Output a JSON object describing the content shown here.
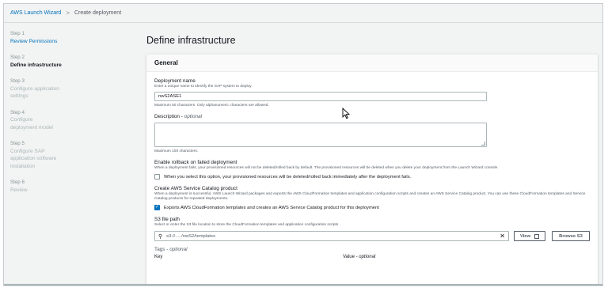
{
  "breadcrumb": {
    "root": "AWS Launch Wizard",
    "separator": ">",
    "current": "Create deployment"
  },
  "steps": [
    {
      "num": "Step 1",
      "title": "Review Permissions",
      "state": "done"
    },
    {
      "num": "Step 2",
      "title": "Define infrastructure",
      "state": "current"
    },
    {
      "num": "Step 3",
      "title": "Configure application settings",
      "state": "pending"
    },
    {
      "num": "Step 4",
      "title": "Configure deployment model",
      "state": "pending"
    },
    {
      "num": "Step 5",
      "title": "Configure SAP application software installation",
      "state": "pending"
    },
    {
      "num": "Step 6",
      "title": "Review",
      "state": "pending"
    }
  ],
  "page_title": "Define infrastructure",
  "panel_title": "General",
  "deployment_name": {
    "label": "Deployment name",
    "description": "Enter a unique name to identify the SAP system to deploy.",
    "value": "nwS2ASE1",
    "hint": "Maximum 50 characters. Only alphanumeric characters are allowed."
  },
  "description_field": {
    "label": "Description",
    "optional": "optional",
    "separator": " - ",
    "hint": "Maximum 100 characters."
  },
  "rollback": {
    "title": "Enable rollback on failed deployment",
    "description": "When a deployment fails, your provisioned resources will not be deleted/rolled back by default. The provisioned resources will be deleted when you delete your deployment from the Launch Wizard console.",
    "checkbox_label": "When you select this option, your provisioned resources will be deleted/rolled back immediately after the deployment fails.",
    "checked": false
  },
  "service_catalog": {
    "title": "Create AWS Service Catalog product",
    "description": "When a deployment is successful, AWS Launch Wizard packages and exports the AWS CloudFormation templates and application configuration scripts and creates an AWS Service Catalog product. You can use these CloudFormation templates and Service Catalog products for repeated deployments.",
    "checkbox_label": "Exports AWS CloudFormation templates and creates an AWS Service Catalog product for this deployment",
    "checked": true,
    "check_glyph": "✓"
  },
  "s3": {
    "label": "S3 file path",
    "description": "Select or enter the S3 file location to store the CloudFormation templates and application configuration scripts",
    "value": "s3://...../nwS2/templates",
    "search_icon": "⚲",
    "clear_icon": "✕",
    "view_label": "View",
    "browse_label": "Browse S3"
  },
  "tags": {
    "label": "Tags",
    "optional": "optional",
    "separator": " - ",
    "key_header": "Key",
    "value_header": "Value",
    "value_optional": "optional"
  }
}
